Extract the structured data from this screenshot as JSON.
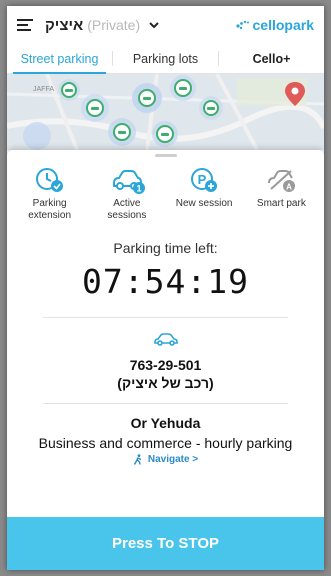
{
  "header": {
    "username": "איציק",
    "account_type": "(Private)",
    "logo_text": "cellopark"
  },
  "tabs": [
    {
      "label": "Street parking",
      "active": true
    },
    {
      "label": "Parking lots",
      "active": false
    },
    {
      "label": "Cello+",
      "active": false
    }
  ],
  "map": {
    "place_label": "JAFFA",
    "marker_icon": "car-pin-icon"
  },
  "actions": [
    {
      "label": "Parking extension",
      "icon": "clock-check-icon"
    },
    {
      "label": "Active sessions",
      "icon": "car-count-icon",
      "badge": "1"
    },
    {
      "label": "New session",
      "icon": "parking-plus-icon"
    },
    {
      "label": "Smart park",
      "icon": "smart-park-icon"
    }
  ],
  "session": {
    "time_left_label": "Parking time left:",
    "time_left": "07:54:19",
    "plate": "763-29-501",
    "car_name": "(רכב של איציק)",
    "city": "Or Yehuda",
    "zone": "Business and commerce - hourly parking",
    "navigate_label": "Navigate >"
  },
  "stop_button": "Press To STOP",
  "colors": {
    "accent": "#2aa6d8",
    "stop_button": "#49c4ea",
    "map_marker": "#3dae6b"
  }
}
